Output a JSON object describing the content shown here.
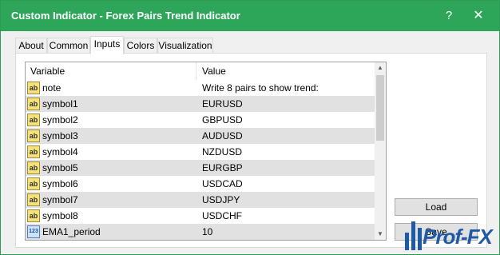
{
  "window": {
    "title": "Custom Indicator - Forex Pairs Trend Indicator",
    "help_label": "?",
    "close_label": "✕",
    "accent_color": "#2ea65a"
  },
  "tabs": [
    {
      "label": "About",
      "active": false
    },
    {
      "label": "Common",
      "active": false
    },
    {
      "label": "Inputs",
      "active": true
    },
    {
      "label": "Colors",
      "active": false
    },
    {
      "label": "Visualization",
      "active": false
    }
  ],
  "grid": {
    "columns": {
      "variable": "Variable",
      "value": "Value"
    },
    "rows": [
      {
        "icon": "ab-string-icon",
        "icon_text": "ab",
        "variable": "note",
        "value": "Write 8 pairs to show trend:"
      },
      {
        "icon": "ab-string-icon",
        "icon_text": "ab",
        "variable": "symbol1",
        "value": "EURUSD"
      },
      {
        "icon": "ab-string-icon",
        "icon_text": "ab",
        "variable": "symbol2",
        "value": "GBPUSD"
      },
      {
        "icon": "ab-string-icon",
        "icon_text": "ab",
        "variable": "symbol3",
        "value": "AUDUSD"
      },
      {
        "icon": "ab-string-icon",
        "icon_text": "ab",
        "variable": "symbol4",
        "value": "NZDUSD"
      },
      {
        "icon": "ab-string-icon",
        "icon_text": "ab",
        "variable": "symbol5",
        "value": "EURGBP"
      },
      {
        "icon": "ab-string-icon",
        "icon_text": "ab",
        "variable": "symbol6",
        "value": "USDCAD"
      },
      {
        "icon": "ab-string-icon",
        "icon_text": "ab",
        "variable": "symbol7",
        "value": "USDJPY"
      },
      {
        "icon": "ab-string-icon",
        "icon_text": "ab",
        "variable": "symbol8",
        "value": "USDCHF"
      },
      {
        "icon": "integer-icon",
        "icon_text": "123",
        "variable": "EMA1_period",
        "value": "10"
      }
    ]
  },
  "buttons": {
    "load": "Load",
    "save": "Save"
  },
  "watermark": {
    "text": "Prof-FX"
  }
}
